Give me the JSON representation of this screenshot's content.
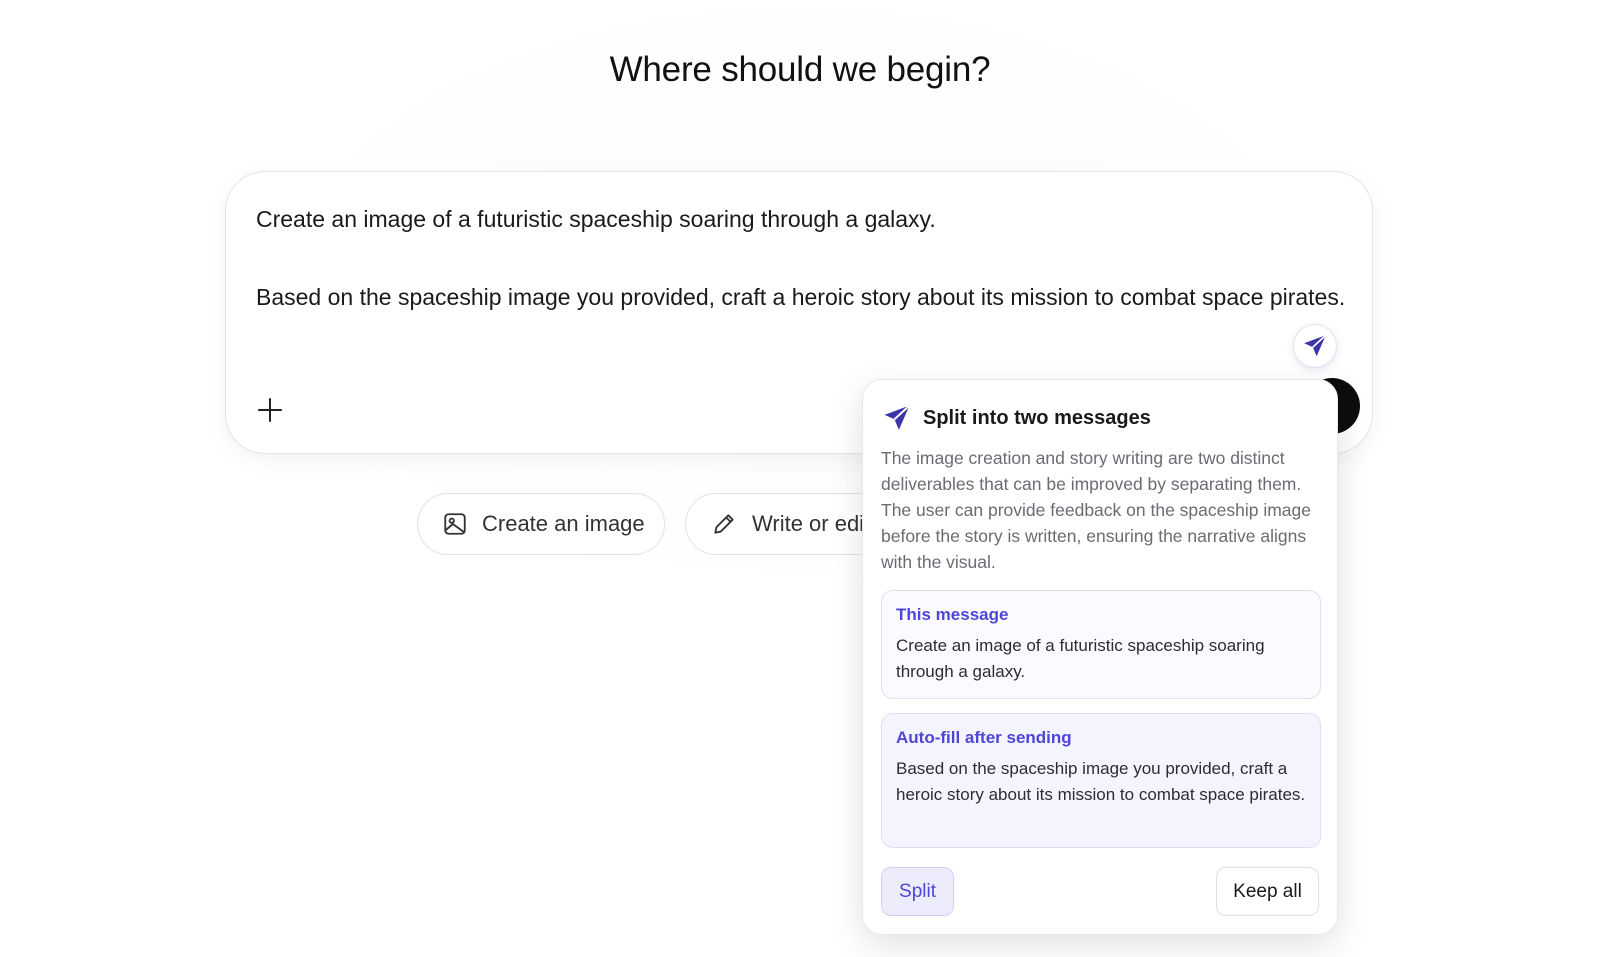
{
  "main": {
    "heading": "Where should we begin?"
  },
  "composer": {
    "paragraphs": [
      "Create an image of a futuristic spaceship soaring through a galaxy.",
      "Based on the spaceship image you provided, craft a heroic story about its mission to combat space pirates."
    ],
    "icons": {
      "add": "plus-icon",
      "send": "paper-plane-icon"
    }
  },
  "chips": [
    {
      "label": "Create an image",
      "icon": "image-icon"
    },
    {
      "label": "Write or edi",
      "icon": "pencil-icon"
    }
  ],
  "popover": {
    "title": "Split into two messages",
    "icon": "paper-plane-icon",
    "description": "The image creation and story writing are two distinct deliverables that can be improved by separating them. The user can provide feedback on the spaceship image before the story is written, ensuring the narrative aligns with the visual.",
    "this_message": {
      "label": "This message",
      "text": "Create an image of a futuristic spaceship soaring through a galaxy."
    },
    "auto_fill": {
      "label": "Auto-fill after sending",
      "text": "Based on the spaceship image you provided, craft a heroic story about its mission to combat space pirates."
    },
    "split_label": "Split",
    "keep_all_label": "Keep all"
  },
  "colors": {
    "accent": "#4f46d6",
    "accent_bg": "#ececfd",
    "plane_icon": "#3b35a8"
  }
}
